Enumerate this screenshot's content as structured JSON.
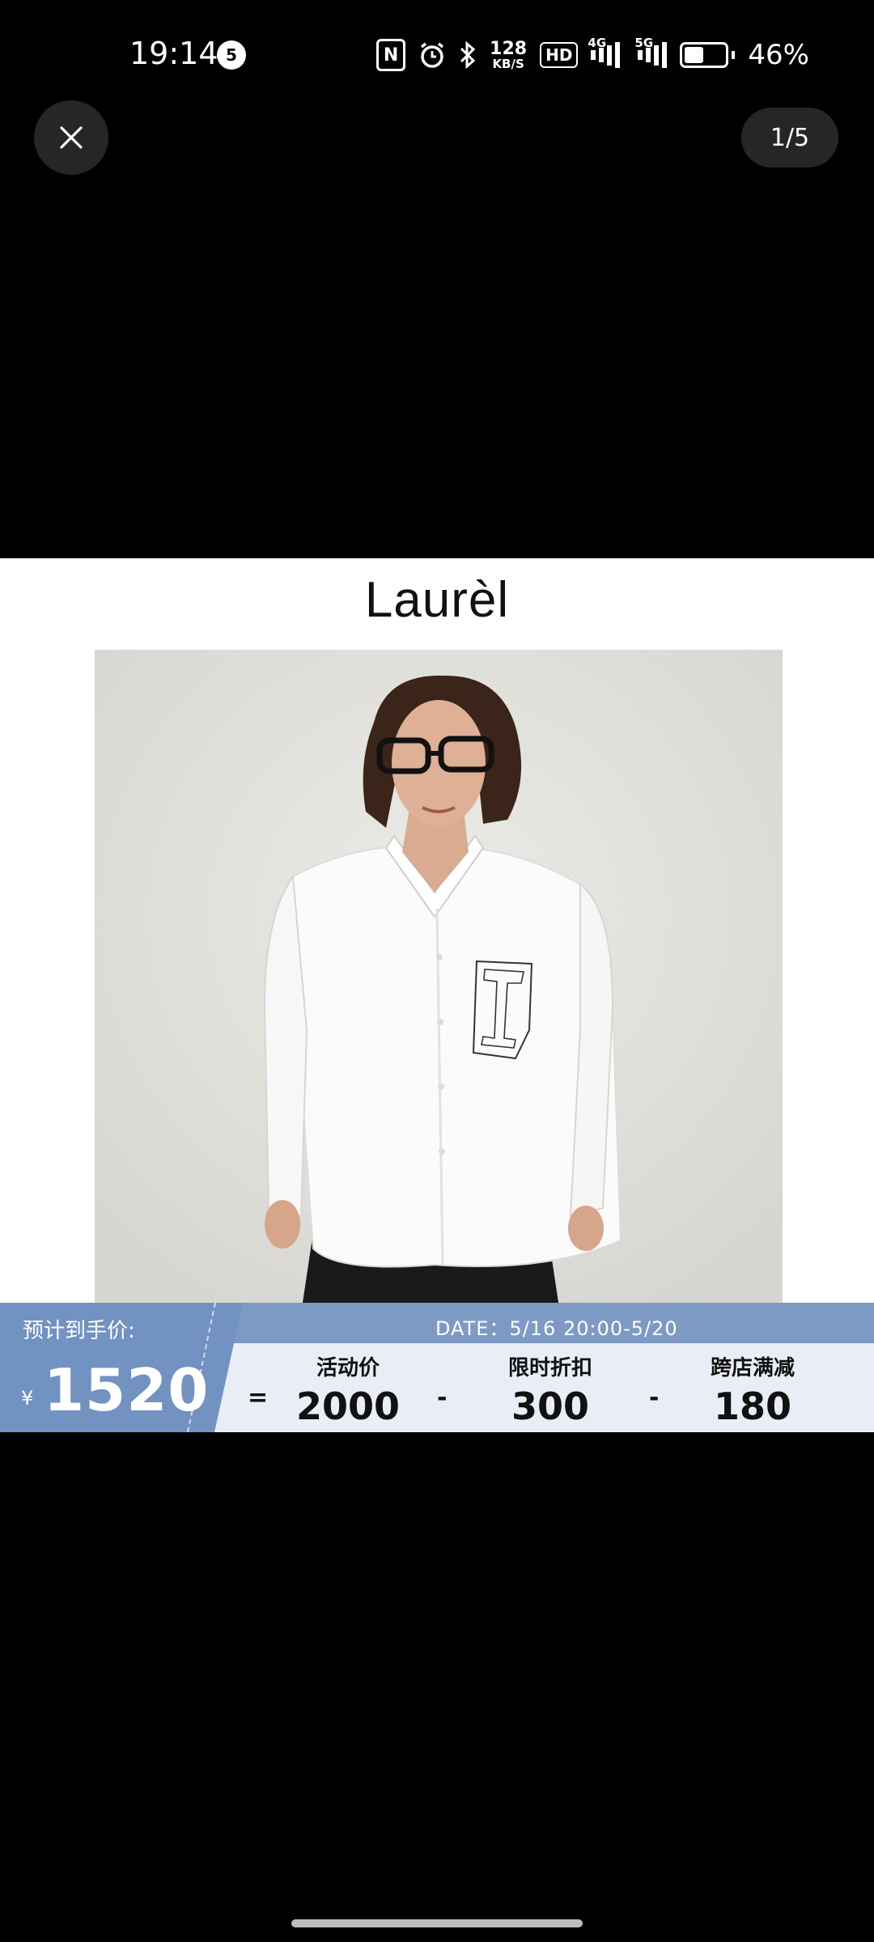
{
  "status_bar": {
    "time": "19:14",
    "notification_count": "5",
    "net_speed_value": "128",
    "net_speed_unit": "KB/S",
    "hd_label": "HD",
    "signal1_tag": "4G",
    "signal2_tag": "5G",
    "battery_percent": "46%",
    "battery_level": 0.46
  },
  "viewer": {
    "page_counter": "1/5"
  },
  "image": {
    "brand": "Laurèl"
  },
  "price_banner": {
    "estimate_label": "预计到手价:",
    "currency": "¥",
    "final_price": "1520",
    "date": "DATE：5/16 20:00-5/20",
    "equals": "=",
    "minus": "-",
    "terms": [
      {
        "label": "活动价",
        "value": "2000"
      },
      {
        "label": "限时折扣",
        "value": "300"
      },
      {
        "label": "跨店满减",
        "value": "180"
      }
    ]
  }
}
